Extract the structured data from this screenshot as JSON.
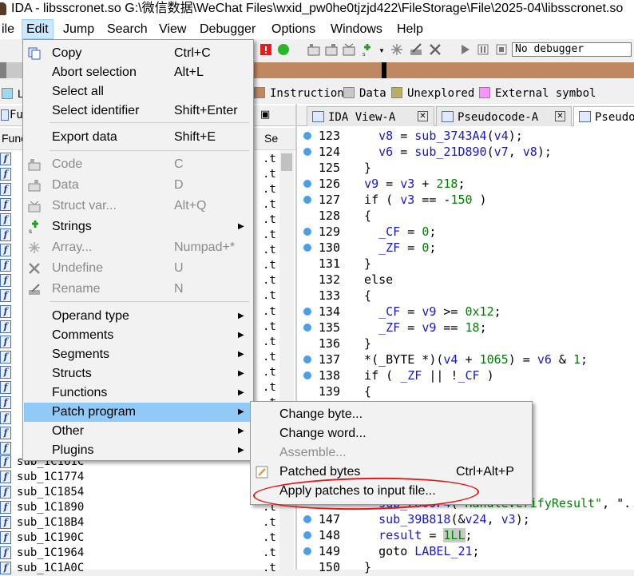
{
  "window": {
    "title": "IDA - libsscronet.so G:\\微信数据\\WeChat Files\\wxid_pw0he0tjzjd422\\FileStorage\\File\\2025-04\\libsscronet.so"
  },
  "menubar": [
    "ile",
    "Edit",
    "Jump",
    "Search",
    "View",
    "Debugger",
    "Options",
    "Windows",
    "Help"
  ],
  "toolbar": {
    "debugger": "No debugger"
  },
  "legend": [
    {
      "label": "L",
      "color": "#a0d8ef"
    },
    {
      "label": "Instruction",
      "color": "#c08860"
    },
    {
      "label": "Data",
      "color": "#c8c8c8"
    },
    {
      "label": "Unexplored",
      "color": "#b8b060"
    },
    {
      "label": "External symbol",
      "color": "#ff90ff"
    }
  ],
  "functions": {
    "tab": "Fu",
    "col_name": "Func",
    "col_seg": "Se",
    "visible_rows": [
      {
        "name": "sub_1C161C",
        "seg": ".t"
      },
      {
        "name": "sub_1C1774",
        "seg": ".t"
      },
      {
        "name": "sub_1C1854",
        "seg": ".t"
      },
      {
        "name": "sub_1C1890",
        "seg": ".t"
      },
      {
        "name": "sub_1C18B4",
        "seg": ".t"
      },
      {
        "name": "sub_1C190C",
        "seg": ".t"
      },
      {
        "name": "sub_1C1964",
        "seg": ".t"
      },
      {
        "name": "sub_1C1A0C",
        "seg": ".t"
      }
    ]
  },
  "tabs": [
    {
      "label": "IDA View-A",
      "active": false
    },
    {
      "label": "Pseudocode-A",
      "active": false
    },
    {
      "label": "Pseudoc",
      "active": true
    }
  ],
  "code": [
    {
      "n": "123",
      "text": "    v8 = sub_3743A4(v4);"
    },
    {
      "n": "124",
      "text": "    v6 = sub_21D890(v7, v8);"
    },
    {
      "n": "125",
      "text": "  }"
    },
    {
      "n": "126",
      "text": "  v9 = v3 + 218;"
    },
    {
      "n": "127",
      "text": "  if ( v3 == -150 )"
    },
    {
      "n": "128",
      "text": "  {"
    },
    {
      "n": "129",
      "text": "    _CF = 0;"
    },
    {
      "n": "130",
      "text": "    _ZF = 0;"
    },
    {
      "n": "131",
      "text": "  }"
    },
    {
      "n": "132",
      "text": "  else"
    },
    {
      "n": "133",
      "text": "  {"
    },
    {
      "n": "134",
      "text": "    _CF = v9 >= 0x12;"
    },
    {
      "n": "135",
      "text": "    _ZF = v9 == 18;"
    },
    {
      "n": "136",
      "text": "  }"
    },
    {
      "n": "137",
      "text": "  *(_BYTE *)(v4 + 1065) = v6 & 1;"
    },
    {
      "n": "138",
      "text": "  if ( _ZF || !_CF )"
    },
    {
      "n": "139",
      "text": "  {"
    }
  ],
  "code_partial": {
    "l142_tail": "40) )",
    "l146_text": "    sub_2809F4(\"HandleVerifyResult\", \"../",
    "l147": {
      "n": "147",
      "text": "    sub_39B818(&v24, v3);"
    },
    "l148": {
      "n": "148",
      "pre": "    result = ",
      "hl": "1LL",
      "post": ";"
    },
    "l149": {
      "n": "149",
      "text": "    goto LABEL_21;"
    },
    "l150": {
      "n": "150",
      "text": "  }"
    }
  },
  "edit_menu": {
    "items": [
      {
        "label": "Copy",
        "shortcut": "Ctrl+C",
        "icon": "copy-icon"
      },
      {
        "label": "Abort selection",
        "shortcut": "Alt+L"
      },
      {
        "label": "Select all",
        "shortcut": ""
      },
      {
        "label": "Select identifier",
        "shortcut": "Shift+Enter"
      },
      {
        "label": "Export data",
        "shortcut": "Shift+E"
      },
      {
        "label": "Code",
        "shortcut": "C",
        "disabled": true,
        "icon": "code-icon"
      },
      {
        "label": "Data",
        "shortcut": "D",
        "disabled": true,
        "icon": "data-icon"
      },
      {
        "label": "Struct var...",
        "shortcut": "Alt+Q",
        "disabled": true,
        "icon": "struct-icon"
      },
      {
        "label": "Strings",
        "submenu": true,
        "icon": "strings-icon"
      },
      {
        "label": "Array...",
        "shortcut": "Numpad+*",
        "disabled": true,
        "icon": "array-icon"
      },
      {
        "label": "Undefine",
        "shortcut": "U",
        "disabled": true,
        "icon": "undefine-icon"
      },
      {
        "label": "Rename",
        "shortcut": "N",
        "disabled": true,
        "icon": "rename-icon"
      },
      {
        "label": "Operand type",
        "submenu": true
      },
      {
        "label": "Comments",
        "submenu": true
      },
      {
        "label": "Segments",
        "submenu": true
      },
      {
        "label": "Structs",
        "submenu": true
      },
      {
        "label": "Functions",
        "submenu": true
      },
      {
        "label": "Patch program",
        "submenu": true,
        "highlight": true
      },
      {
        "label": "Other",
        "submenu": true
      },
      {
        "label": "Plugins",
        "submenu": true
      }
    ]
  },
  "patch_menu": {
    "items": [
      {
        "label": "Change byte..."
      },
      {
        "label": "Change word..."
      },
      {
        "label": "Assemble...",
        "disabled": true
      },
      {
        "label": "Patched bytes",
        "shortcut": "Ctrl+Alt+P",
        "icon": "patched-bytes-icon"
      },
      {
        "label": "Apply patches to input file..."
      }
    ]
  },
  "colors": {
    "menu_highlight": "#91c9f7",
    "annotation": "#e21a1a",
    "code_blue": "#1818c8",
    "breakpoint": "#4aa0e8"
  }
}
